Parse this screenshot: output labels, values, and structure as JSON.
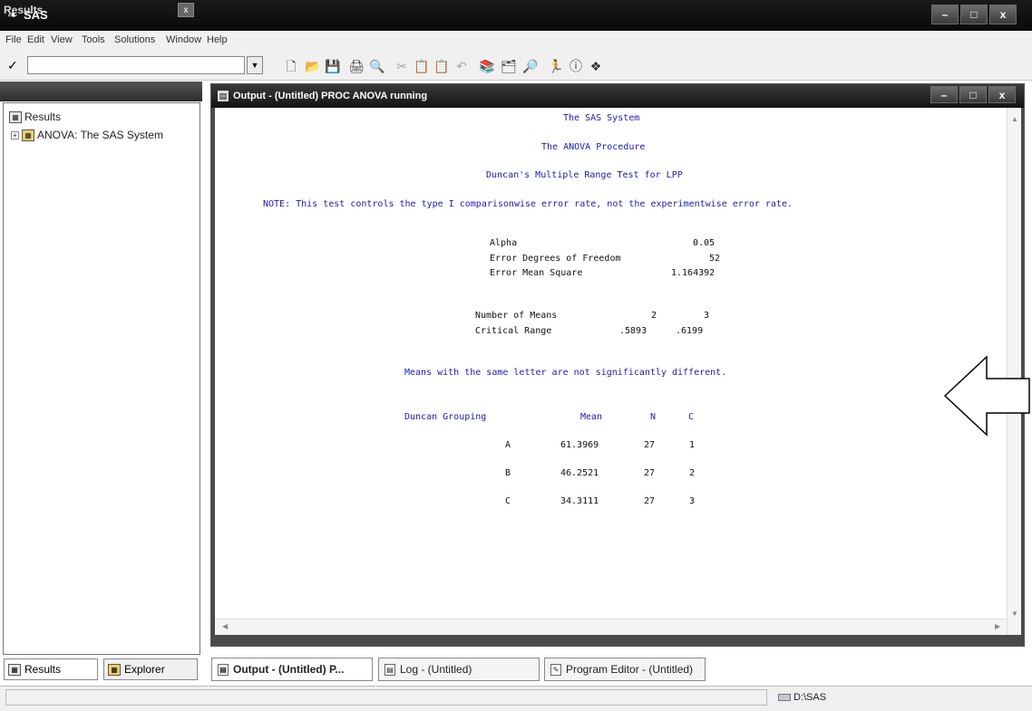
{
  "app": {
    "title": "SAS",
    "window_buttons": [
      "–",
      "□",
      "x"
    ]
  },
  "menu": [
    "File",
    "Edit",
    "View",
    "Tools",
    "Solutions",
    "Window",
    "Help"
  ],
  "toolbar": {
    "command_value": "",
    "icons": [
      "new-icon",
      "open-icon",
      "save-icon",
      "print-icon",
      "print-preview-icon",
      "cut-icon",
      "copy-icon",
      "paste-icon",
      "undo-icon",
      "library-icon",
      "explorer-icon",
      "query-icon",
      "run-icon",
      "help-icon",
      "submit-icon"
    ]
  },
  "results_pane": {
    "title": "Results",
    "close": "x",
    "tree": [
      {
        "label": "Results",
        "level": 0
      },
      {
        "label": "ANOVA:  The SAS System",
        "level": 1
      }
    ],
    "tabs": [
      "Results",
      "Explorer"
    ]
  },
  "output_window": {
    "title": "Output - (Untitled)  PROC ANOVA running",
    "lines": {
      "system": "The SAS System",
      "procedure": "The ANOVA Procedure",
      "test": "Duncan's Multiple Range Test for LPP",
      "note": "NOTE: This test controls the type I comparisonwise error rate, not the experimentwise error rate."
    },
    "stats": [
      {
        "label": "Alpha",
        "value": "0.05"
      },
      {
        "label": "Error Degrees of Freedom",
        "value": "52"
      },
      {
        "label": "Error Mean Square",
        "value": "1.164392"
      }
    ],
    "range_table": {
      "row1_label": "Number of Means",
      "row1_values": [
        "2",
        "3"
      ],
      "row2_label": "Critical Range",
      "row2_values": [
        ".5893",
        ".6199"
      ]
    },
    "means_note": "Means with the same letter are not significantly different.",
    "groups_header": [
      "Duncan Grouping",
      "Mean",
      "N",
      "C"
    ],
    "groups": [
      {
        "grouping": "A",
        "mean": "61.3969",
        "n": "27",
        "c": "1"
      },
      {
        "grouping": "B",
        "mean": "46.2521",
        "n": "27",
        "c": "2"
      },
      {
        "grouping": "C",
        "mean": "34.3111",
        "n": "27",
        "c": "3"
      }
    ]
  },
  "window_tabs": [
    "Output - (Untitled)  P...",
    "Log - (Untitled)",
    "Program Editor - (Untitled)"
  ],
  "status": {
    "path": "D:\\SAS"
  }
}
